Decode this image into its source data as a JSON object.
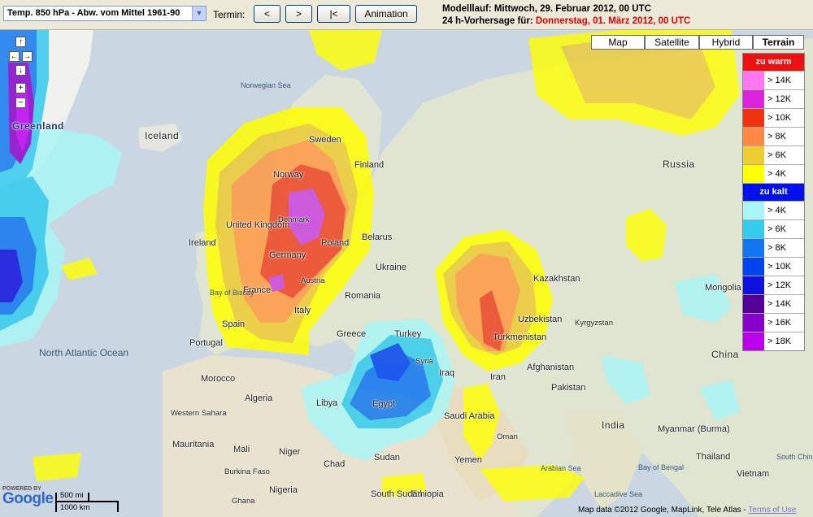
{
  "toolbar": {
    "parameter_select": "Temp. 850 hPa - Abw. vom Mittel 1961-90",
    "termin_label": "Termin:",
    "prev_label": "<",
    "next_label": ">",
    "first_label": "|<",
    "animation_label": "Animation",
    "modelllauf_label": "Modelllauf:",
    "modelllauf_value": "Mittwoch, 29. Februar 2012, 00 UTC",
    "forecast_label": "24 h-Vorhersage für:",
    "forecast_value": "Donnerstag, 01. März 2012, 00 UTC"
  },
  "map_types": [
    {
      "label": "Map",
      "active": false
    },
    {
      "label": "Satellite",
      "active": false
    },
    {
      "label": "Hybrid",
      "active": false
    },
    {
      "label": "Terrain",
      "active": true
    }
  ],
  "legend": {
    "warm_title": "zu warm",
    "warm_color": "#ee1111",
    "warm": [
      {
        "label": "> 14K",
        "color": "#ff77ee"
      },
      {
        "label": "> 12K",
        "color": "#dd22dd"
      },
      {
        "label": "> 10K",
        "color": "#ee3311"
      },
      {
        "label": "> 8K",
        "color": "#ff8844"
      },
      {
        "label": "> 6K",
        "color": "#eecc33"
      },
      {
        "label": "> 4K",
        "color": "#ffff00"
      }
    ],
    "cold_title": "zu kalt",
    "cold_color": "#0011ee",
    "cold": [
      {
        "label": "> 4K",
        "color": "#aaf6f6"
      },
      {
        "label": "> 6K",
        "color": "#33ccee"
      },
      {
        "label": "> 8K",
        "color": "#1177ee"
      },
      {
        "label": "> 10K",
        "color": "#0044ee"
      },
      {
        "label": "> 12K",
        "color": "#1111dd"
      },
      {
        "label": "> 14K",
        "color": "#550099"
      },
      {
        "label": "> 16K",
        "color": "#8800cc"
      },
      {
        "label": "> 18K",
        "color": "#bb00ee"
      }
    ]
  },
  "nav": {
    "up": "↑",
    "left": "←",
    "right": "→",
    "down": "↓",
    "zoom_in": "+",
    "zoom_out": "−"
  },
  "scale": {
    "miles": "500 mi",
    "km": "1000 km"
  },
  "google": {
    "powered_by": "POWERED BY",
    "logo": "Google"
  },
  "attribution": {
    "text": "Map data ©2012 Google, MapLink, Tele Atlas - ",
    "terms": "Terms of Use"
  },
  "places": {
    "greenland": "Greenland",
    "iceland": "Iceland",
    "norwegian_sea": "Norwegian Sea",
    "sweden": "Sweden",
    "finland": "Finland",
    "norway": "Norway",
    "denmark": "Denmark",
    "united_kingdom": "United Kingdom",
    "ireland": "Ireland",
    "germany": "Germany",
    "poland": "Poland",
    "belarus": "Belarus",
    "ukraine": "Ukraine",
    "france": "France",
    "austria": "Austria",
    "bay_of_biscay": "Bay of Biscay",
    "italy": "Italy",
    "romania": "Romania",
    "spain": "Spain",
    "portugal": "Portugal",
    "greece": "Greece",
    "turkey": "Turkey",
    "syria": "Syria",
    "iraq": "Iraq",
    "iran": "Iran",
    "north_atlantic_ocean": "North Atlantic Ocean",
    "russia": "Russia",
    "kazakhstan": "Kazakhstan",
    "uzbekistan": "Uzbekistan",
    "turkmenistan": "Turkmenistan",
    "kyrgyzstan": "Kyrgyzstan",
    "mongolia": "Mongolia",
    "china": "China",
    "afghanistan": "Afghanistan",
    "pakistan": "Pakistan",
    "india": "India",
    "morocco": "Morocco",
    "algeria": "Algeria",
    "libya": "Libya",
    "egypt": "Egypt",
    "western_sahara": "Western Sahara",
    "mauritania": "Mauritania",
    "mali": "Mali",
    "niger": "Niger",
    "chad": "Chad",
    "sudan": "Sudan",
    "saudi_arabia": "Saudi Arabia",
    "yemen": "Yemen",
    "oman": "Oman",
    "ethiopia": "Ethiopia",
    "south_sudan": "South Sudan",
    "nigeria": "Nigeria",
    "burkina_faso": "Burkina Faso",
    "ghana": "Ghana",
    "myanmar": "Myanmar (Burma)",
    "thailand": "Thailand",
    "vietnam": "Vietnam",
    "south_china_sea": "South China Sea",
    "laccadive_sea": "Laccadive Sea",
    "bay_of_bengal": "Bay of Bengal",
    "arabian_sea": "Arabian Sea"
  }
}
